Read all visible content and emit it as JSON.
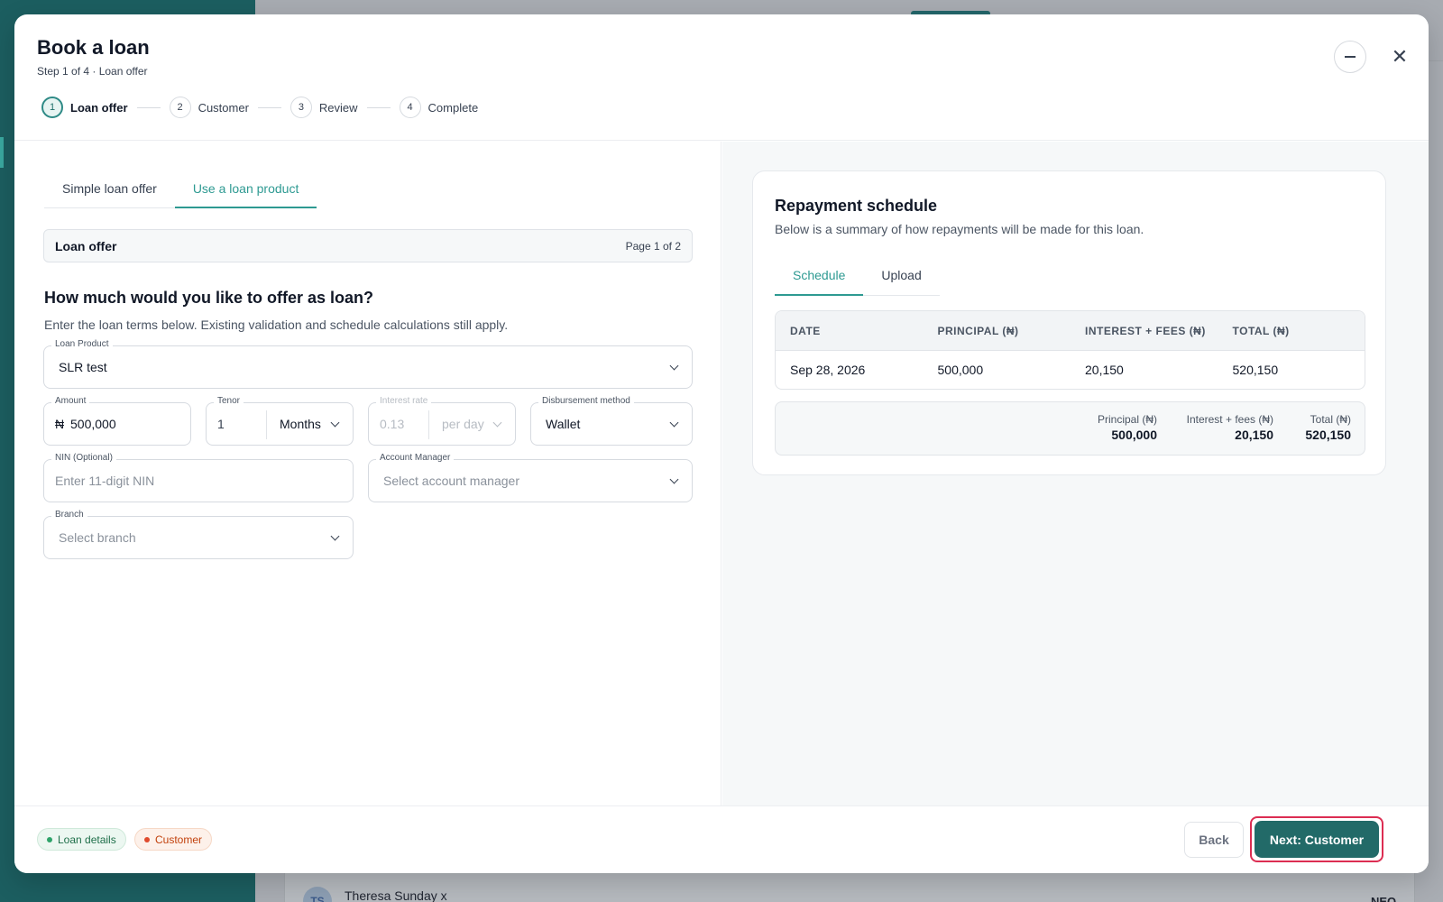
{
  "background": {
    "row_avatar": "TS",
    "row_name": "Theresa Sunday x",
    "row_badge": "NEO"
  },
  "modal": {
    "title": "Book a loan",
    "subtitle": "Step 1 of 4 · Loan offer",
    "steps": [
      {
        "num": "1",
        "label": "Loan offer",
        "active": true
      },
      {
        "num": "2",
        "label": "Customer",
        "active": false
      },
      {
        "num": "3",
        "label": "Review",
        "active": false
      },
      {
        "num": "4",
        "label": "Complete",
        "active": false
      }
    ]
  },
  "left": {
    "tabs": [
      "Simple loan offer",
      "Use a loan product"
    ],
    "active_tab": "Use a loan product",
    "section_title": "Loan offer",
    "section_page": "Page 1 of 2",
    "question": "How much would you like to offer as loan?",
    "question_sub": "Enter the loan terms below. Existing validation and schedule calculations still apply.",
    "loan_product": {
      "label": "Loan Product",
      "value": "SLR test"
    },
    "amount": {
      "label": "Amount",
      "currency": "₦",
      "value": "500,000"
    },
    "tenor": {
      "label": "Tenor",
      "value": "1",
      "unit": "Months"
    },
    "interest_rate": {
      "label": "Interest rate",
      "value": "0.13",
      "unit": "per day",
      "disabled": true
    },
    "disbursement": {
      "label": "Disbursement method",
      "value": "Wallet"
    },
    "nin": {
      "label": "NIN (Optional)",
      "placeholder": "Enter 11-digit NIN"
    },
    "account_manager": {
      "label": "Account Manager",
      "placeholder": "Select account manager"
    },
    "branch": {
      "label": "Branch",
      "placeholder": "Select branch"
    }
  },
  "schedule": {
    "title": "Repayment schedule",
    "subtitle": "Below is a summary of how repayments will be made for this loan.",
    "tabs": [
      "Schedule",
      "Upload"
    ],
    "active_tab": "Schedule",
    "columns": [
      "DATE",
      "PRINCIPAL (₦)",
      "INTEREST + FEES (₦)",
      "TOTAL (₦)"
    ],
    "rows": [
      [
        "Sep 28, 2026",
        "500,000",
        "20,150",
        "520,150"
      ]
    ],
    "summary": {
      "principal_label": "Principal (₦)",
      "principal_value": "500,000",
      "interest_label": "Interest + fees (₦)",
      "interest_value": "20,150",
      "total_label": "Total (₦)",
      "total_value": "520,150"
    }
  },
  "footer": {
    "chip_loan": "Loan details",
    "chip_customer": "Customer",
    "back": "Back",
    "next": "Next: Customer"
  },
  "colors": {
    "accent": "#2e9a92",
    "primary_button": "#226a68",
    "highlight_outline": "#dc2d52"
  }
}
